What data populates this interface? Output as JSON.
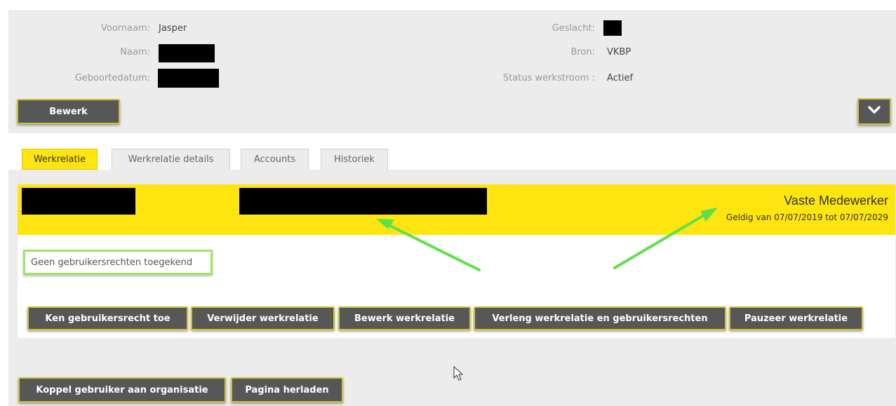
{
  "profile": {
    "voornaam_label": "Voornaam:",
    "voornaam_value": "Jasper",
    "naam_label": "Naam:",
    "geboortedatum_label": "Geboortedatum:",
    "geslacht_label": "Geslacht:",
    "bron_label": "Bron:",
    "bron_value": "VKBP",
    "status_label": "Status werkstroom :",
    "status_value": "Actief"
  },
  "actions": {
    "bewerk_label": "Bewerk",
    "expand_icon": "chevron-down-icon"
  },
  "tabs": [
    {
      "label": "Werkrelatie",
      "active": true
    },
    {
      "label": "Werkrelatie details",
      "active": false
    },
    {
      "label": "Accounts",
      "active": false
    },
    {
      "label": "Historiek",
      "active": false
    }
  ],
  "werkrelatie": {
    "type": "Vaste Medewerker",
    "validity": "Geldig van 07/07/2019 tot 07/07/2029",
    "rights_status": "Geen gebruikersrechten toegekend",
    "buttons": [
      "Ken gebruikersrecht toe",
      "Verwijder werkrelatie",
      "Bewerk werkrelatie",
      "Verleng werkrelatie en gebruikersrechten",
      "Pauzeer werkrelatie"
    ]
  },
  "footer": {
    "buttons": [
      "Koppel gebruiker aan organisatie",
      "Pagina herladen"
    ]
  },
  "colors": {
    "accent_yellow": "#fee50f",
    "button_gray": "#575757",
    "button_border": "#cfc23a",
    "annotation_green": "#5fe04a"
  }
}
